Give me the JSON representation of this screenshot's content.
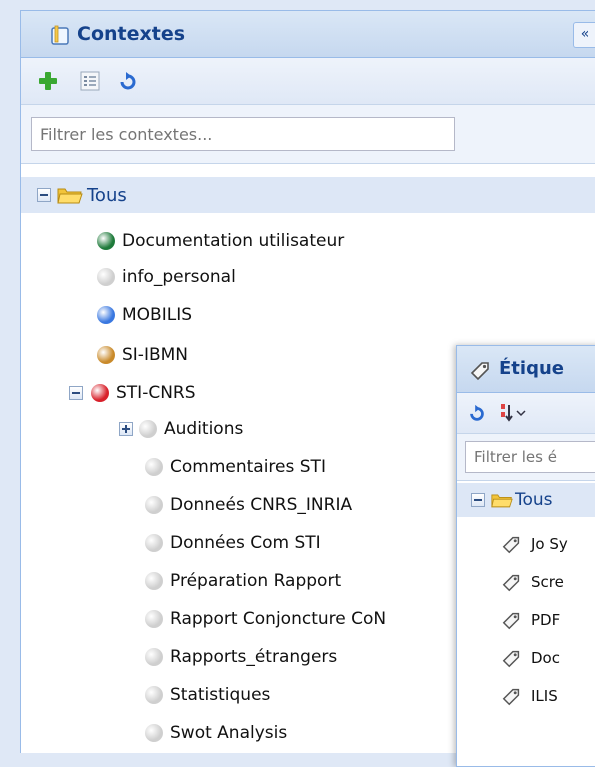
{
  "contexts_panel": {
    "title": "Contextes",
    "collapse_glyph": "«",
    "toolbar": {
      "add_icon": "plus-icon",
      "list_icon": "list-icon",
      "refresh_icon": "refresh-icon"
    },
    "filter": {
      "placeholder": "Filtrer les contextes..."
    },
    "tree": {
      "root_label": "Tous",
      "items": [
        {
          "label": "Documentation utilisateur",
          "color": "#1e7a3a"
        },
        {
          "label": "info_personal",
          "color": "#cfcfcf"
        },
        {
          "label": "MOBILIS",
          "color": "#3a78e0"
        },
        {
          "label": "SI-IBMN",
          "color": "#c98a2a"
        },
        {
          "label": "STI-CNRS",
          "color": "#d8202a"
        }
      ],
      "sti_children": [
        {
          "label": "Auditions"
        },
        {
          "label": "Commentaires STI"
        },
        {
          "label": "Donneés CNRS_INRIA"
        },
        {
          "label": "Données Com STI"
        },
        {
          "label": "Préparation Rapport"
        },
        {
          "label": "Rapport Conjoncture CoN"
        },
        {
          "label": "Rapports_étrangers"
        },
        {
          "label": "Statistiques"
        },
        {
          "label": "Swot Analysis"
        }
      ]
    }
  },
  "tags_panel": {
    "title": "Étique",
    "filter": {
      "placeholder": "Filtrer les é"
    },
    "root_label": "Tous",
    "tags": [
      {
        "label": "Jo Sy"
      },
      {
        "label": "Scre"
      },
      {
        "label": "PDF"
      },
      {
        "label": "Doc"
      },
      {
        "label": "ILIS"
      }
    ]
  },
  "colors": {
    "accent": "#15428b",
    "border": "#99bbe8",
    "header_bg": "#dae7f6",
    "child_dot": "#cfcfcf"
  }
}
